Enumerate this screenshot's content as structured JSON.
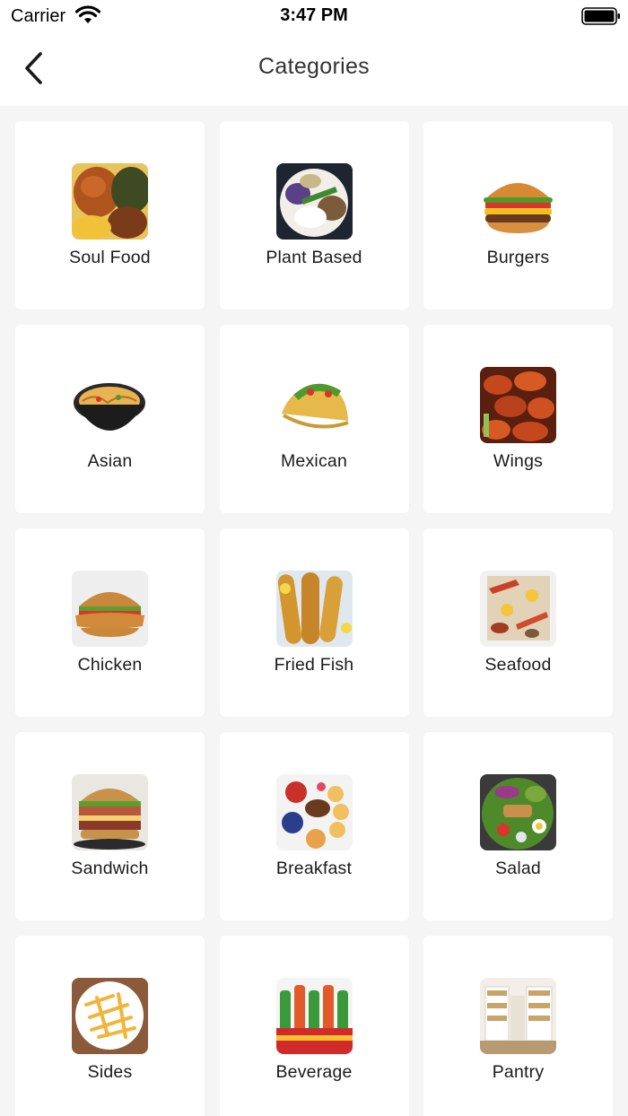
{
  "status_bar": {
    "carrier": "Carrier",
    "time": "3:47 PM",
    "wifi_icon": "wifi-icon",
    "battery_icon": "battery-full-icon"
  },
  "nav": {
    "title": "Categories",
    "back_icon": "chevron-left-icon"
  },
  "categories": [
    {
      "label": "Soul Food",
      "image": "soul-food-plate"
    },
    {
      "label": "Plant Based",
      "image": "plant-based-plate"
    },
    {
      "label": "Burgers",
      "image": "burger"
    },
    {
      "label": "Asian",
      "image": "noodle-bowl"
    },
    {
      "label": "Mexican",
      "image": "taco"
    },
    {
      "label": "Wings",
      "image": "buffalo-wings"
    },
    {
      "label": "Chicken",
      "image": "chicken-sandwich"
    },
    {
      "label": "Fried Fish",
      "image": "fried-fish"
    },
    {
      "label": "Seafood",
      "image": "seafood-boil"
    },
    {
      "label": "Sandwich",
      "image": "deli-sandwich"
    },
    {
      "label": "Breakfast",
      "image": "breakfast-platter"
    },
    {
      "label": "Salad",
      "image": "cobb-salad"
    },
    {
      "label": "Sides",
      "image": "french-fries"
    },
    {
      "label": "Beverage",
      "image": "soda-bottles"
    },
    {
      "label": "Pantry",
      "image": "pantry-shelves"
    }
  ],
  "colors": {
    "background": "#f5f5f5",
    "card": "#ffffff",
    "title": "#333333"
  }
}
